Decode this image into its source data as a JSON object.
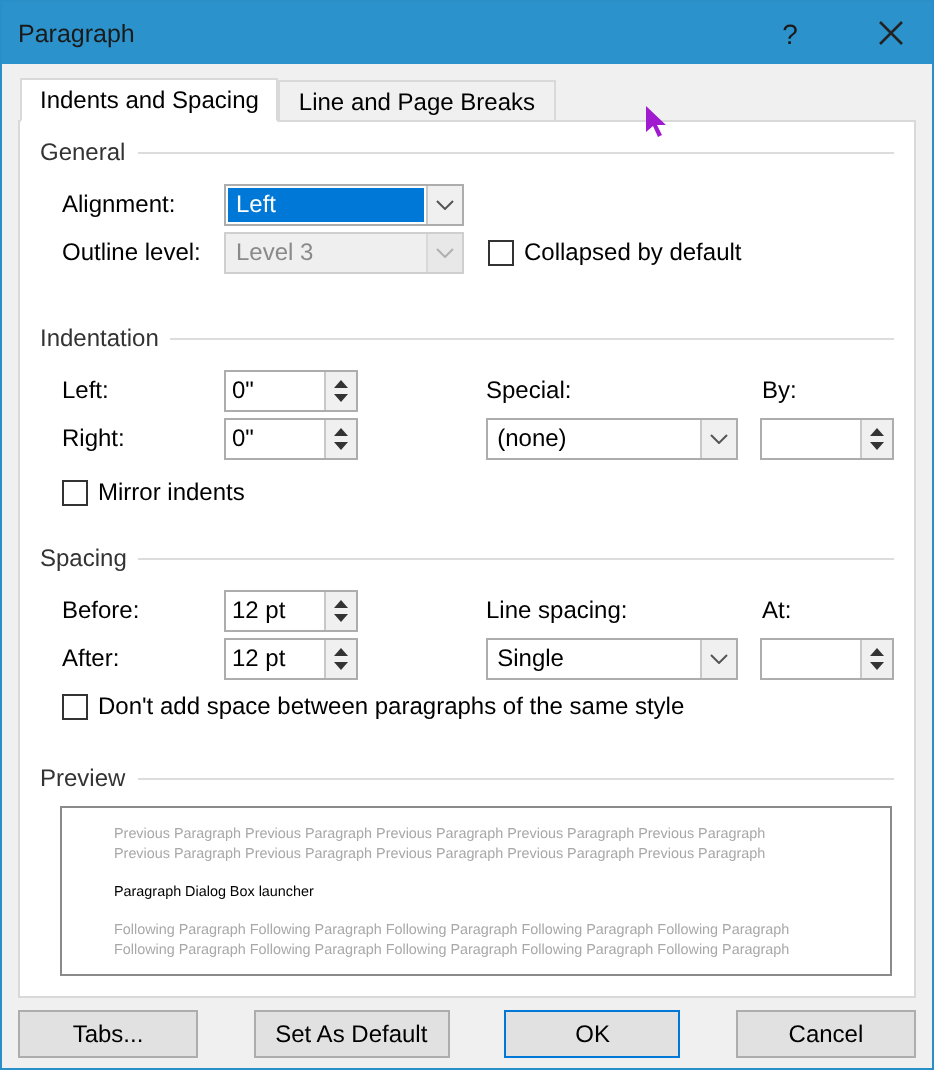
{
  "window": {
    "title": "Paragraph",
    "help": "?"
  },
  "tabs": [
    {
      "label": "Indents and Spacing",
      "selected": true
    },
    {
      "label": "Line and Page Breaks",
      "selected": false
    }
  ],
  "general": {
    "heading": "General",
    "alignment": {
      "label": "Alignment:",
      "value": "Left",
      "focused": true
    },
    "outline_level": {
      "label": "Outline level:",
      "value": "Level 3",
      "disabled": true
    },
    "collapsed": {
      "label": "Collapsed by default",
      "checked": false
    }
  },
  "indentation": {
    "heading": "Indentation",
    "left": {
      "label": "Left:",
      "value": "0\""
    },
    "right": {
      "label": "Right:",
      "value": "0\""
    },
    "special": {
      "label": "Special:",
      "value": "(none)"
    },
    "by": {
      "label": "By:"
    },
    "mirror": {
      "label": "Mirror indents",
      "checked": false
    }
  },
  "spacing": {
    "heading": "Spacing",
    "before": {
      "label": "Before:",
      "value": "12 pt"
    },
    "after": {
      "label": "After:",
      "value": "12 pt"
    },
    "line_spacing": {
      "label": "Line spacing:",
      "value": "Single"
    },
    "at": {
      "label": "At:"
    },
    "dont_add": {
      "label": "Don't add space between paragraphs of the same style",
      "checked": false
    }
  },
  "preview": {
    "heading": "Preview",
    "lines": [
      {
        "kind": "previous",
        "text": "Previous Paragraph Previous Paragraph Previous Paragraph Previous Paragraph Previous Paragraph"
      },
      {
        "kind": "previous",
        "text": "Previous Paragraph Previous Paragraph Previous Paragraph Previous Paragraph Previous Paragraph"
      },
      {
        "kind": "current",
        "text": "Paragraph Dialog Box launcher"
      },
      {
        "kind": "following",
        "text": "Following Paragraph Following Paragraph Following Paragraph Following Paragraph Following Paragraph"
      },
      {
        "kind": "following",
        "text": "Following Paragraph Following Paragraph Following Paragraph Following Paragraph Following Paragraph"
      }
    ]
  },
  "buttons": [
    {
      "label": "Tabs...",
      "default": false
    },
    {
      "label": "Set As Default",
      "default": false
    },
    {
      "label": "OK",
      "default": true
    },
    {
      "label": "Cancel",
      "default": false
    }
  ]
}
